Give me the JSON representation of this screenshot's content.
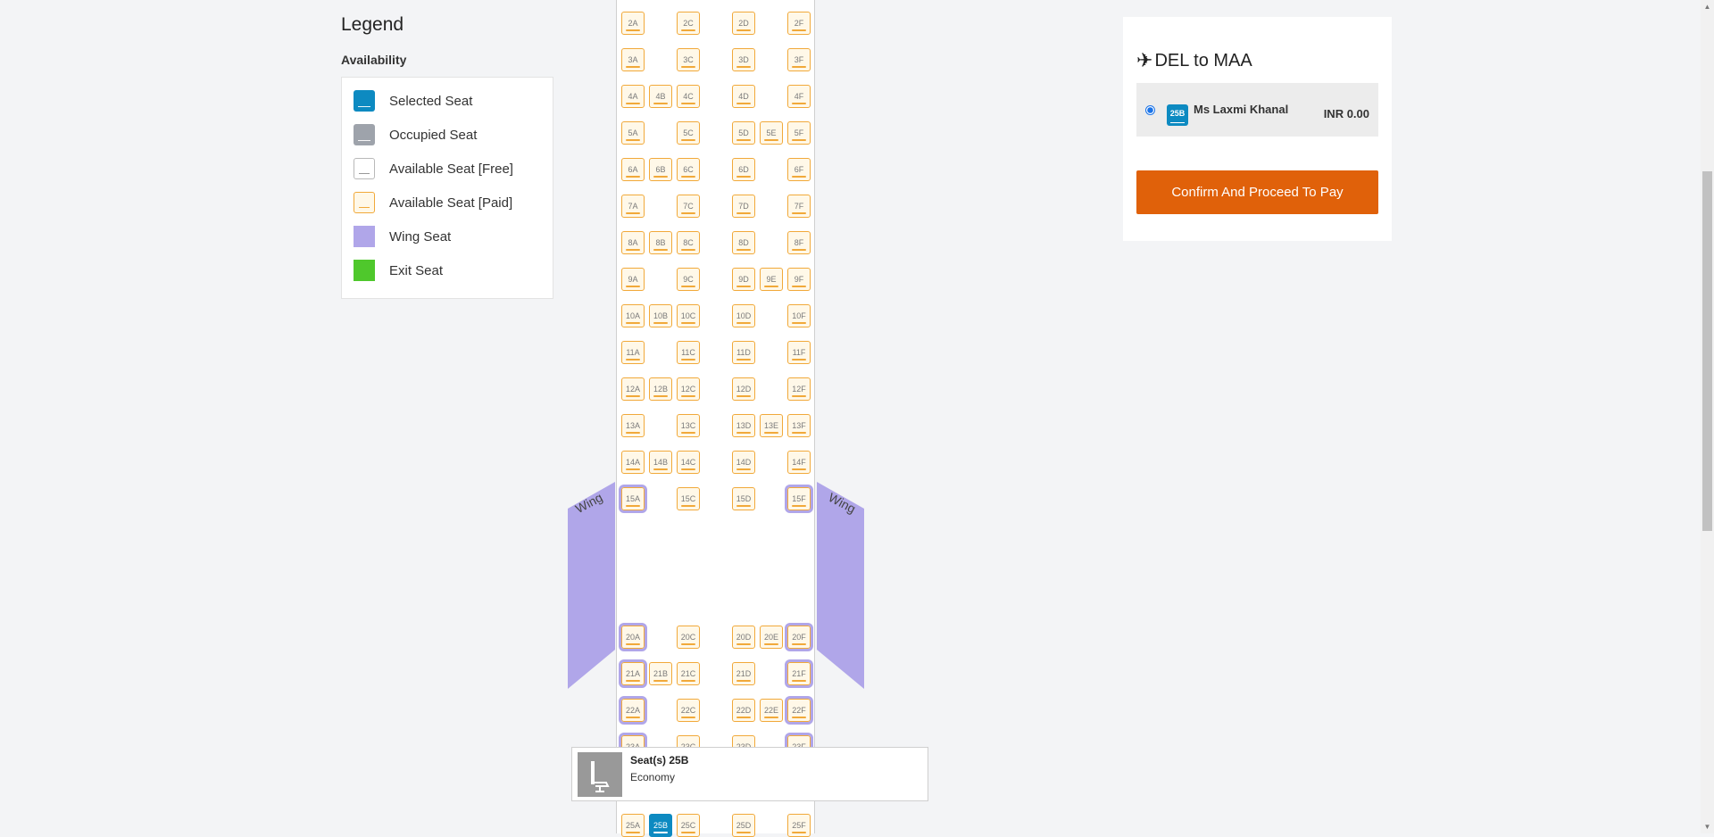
{
  "legend": {
    "title": "Legend",
    "subtitle": "Availability",
    "items": [
      {
        "label": "Selected Seat",
        "type": "selected"
      },
      {
        "label": "Occupied Seat",
        "type": "occupied"
      },
      {
        "label": "Available Seat [Free]",
        "type": "free"
      },
      {
        "label": "Available Seat [Paid]",
        "type": "paid"
      },
      {
        "label": "Wing Seat",
        "type": "wing"
      },
      {
        "label": "Exit Seat",
        "type": "exit"
      }
    ]
  },
  "wing_label": "Wing",
  "seat_rows": [
    {
      "row": "2",
      "seats": [
        "2A",
        "",
        "2C",
        "2D",
        "",
        "2F"
      ]
    },
    {
      "row": "3",
      "seats": [
        "3A",
        "",
        "3C",
        "3D",
        "",
        "3F"
      ]
    },
    {
      "row": "4",
      "seats": [
        "4A",
        "4B",
        "4C",
        "4D",
        "",
        "4F"
      ]
    },
    {
      "row": "5",
      "seats": [
        "5A",
        "",
        "5C",
        "5D",
        "5E",
        "5F"
      ]
    },
    {
      "row": "6",
      "seats": [
        "6A",
        "6B",
        "6C",
        "6D",
        "",
        "6F"
      ]
    },
    {
      "row": "7",
      "seats": [
        "7A",
        "",
        "7C",
        "7D",
        "",
        "7F"
      ]
    },
    {
      "row": "8",
      "seats": [
        "8A",
        "8B",
        "8C",
        "8D",
        "",
        "8F"
      ]
    },
    {
      "row": "9",
      "seats": [
        "9A",
        "",
        "9C",
        "9D",
        "9E",
        "9F"
      ]
    },
    {
      "row": "10",
      "seats": [
        "10A",
        "10B",
        "10C",
        "10D",
        "",
        "10F"
      ]
    },
    {
      "row": "11",
      "seats": [
        "11A",
        "",
        "11C",
        "11D",
        "",
        "11F"
      ]
    },
    {
      "row": "12",
      "seats": [
        "12A",
        "12B",
        "12C",
        "12D",
        "",
        "12F"
      ]
    },
    {
      "row": "13",
      "seats": [
        "13A",
        "",
        "13C",
        "13D",
        "13E",
        "13F"
      ]
    },
    {
      "row": "14",
      "seats": [
        "14A",
        "14B",
        "14C",
        "14D",
        "",
        "14F"
      ]
    },
    {
      "row": "15",
      "seats": [
        "15A",
        "",
        "15C",
        "15D",
        "",
        "15F"
      ],
      "wing": [
        0,
        5
      ]
    },
    {
      "row": "20",
      "seats": [
        "20A",
        "",
        "20C",
        "20D",
        "20E",
        "20F"
      ],
      "wing": [
        0,
        5
      ],
      "gap_before": true
    },
    {
      "row": "21",
      "seats": [
        "21A",
        "21B",
        "21C",
        "21D",
        "",
        "21F"
      ],
      "wing": [
        0,
        5
      ]
    },
    {
      "row": "22",
      "seats": [
        "22A",
        "",
        "22C",
        "22D",
        "22E",
        "22F"
      ],
      "wing": [
        0,
        5
      ]
    },
    {
      "row": "23",
      "seats": [
        "23A",
        "",
        "23C",
        "23D",
        "",
        "23F"
      ],
      "wing": [
        0,
        5
      ]
    },
    {
      "row": "25",
      "seats": [
        "25A",
        "25B",
        "25C",
        "25D",
        "",
        "25F"
      ],
      "selected": "25B",
      "gap_before": true
    }
  ],
  "tooltip": {
    "title": "Seat(s) 25B",
    "cabin": "Economy"
  },
  "panel": {
    "route": "DEL to MAA",
    "passenger": {
      "seat": "25B",
      "name": "Ms Laxmi Khanal",
      "price": "INR 0.00"
    },
    "confirm_label": "Confirm And Proceed To Pay"
  },
  "colors": {
    "selected": "#0d8ac1",
    "occupied": "#9ea3ab",
    "paid_border": "#f1a93a",
    "wing": "#b0a6e9",
    "exit": "#4fc82c",
    "confirm_button": "#e0610a"
  }
}
